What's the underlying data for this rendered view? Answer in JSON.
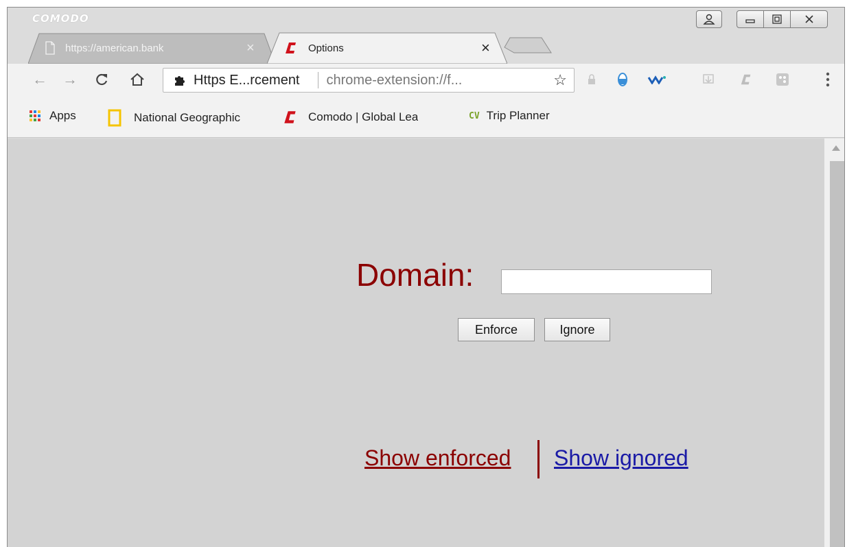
{
  "window": {
    "brand": "COMODO",
    "controls": {
      "profile_icon": "person-icon",
      "minimize_icon": "minimize-icon",
      "maximize_icon": "maximize-icon",
      "close_icon": "close-icon"
    }
  },
  "tabs": [
    {
      "label": "https://american.bank",
      "icon": "page-icon",
      "active": false
    },
    {
      "label": "Options",
      "icon": "comodo-c-icon",
      "active": true
    }
  ],
  "toolbar": {
    "omnibox": {
      "title": "Https E...rcement",
      "url": "chrome-extension://f..."
    }
  },
  "bookmarks": [
    {
      "label": "Apps",
      "icon": "apps-grid-icon"
    },
    {
      "label": "National Geographic",
      "icon": "natgeo-icon"
    },
    {
      "label": "Comodo | Global Lea",
      "icon": "comodo-c-icon"
    },
    {
      "label": "Trip Planner",
      "icon": "cv-icon",
      "icon_text": "CV"
    }
  ],
  "page": {
    "domain_label": "Domain:",
    "domain_value": "",
    "enforce_label": "Enforce",
    "ignore_label": "Ignore",
    "show_enforced_label": "Show enforced",
    "show_ignored_label": "Show ignored"
  },
  "colors": {
    "accent_red": "#8b0000",
    "link_blue": "#1a1aa6",
    "comodo_red": "#d0121c",
    "page_bg": "#d3d3d3"
  }
}
